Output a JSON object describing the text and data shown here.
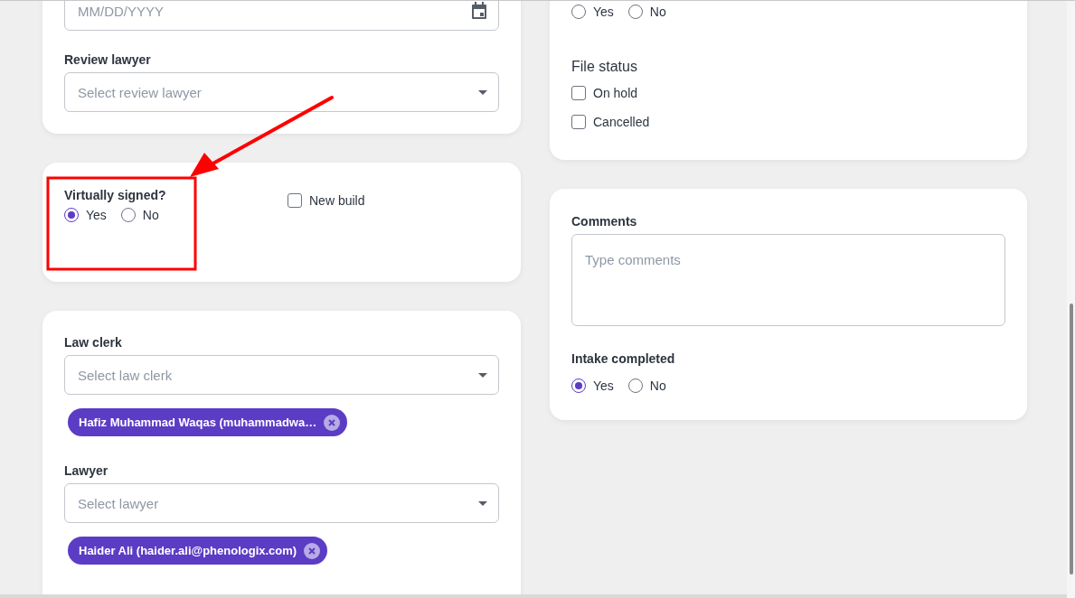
{
  "date_field": {
    "placeholder": "MM/DD/YYYY"
  },
  "review_lawyer": {
    "label": "Review lawyer",
    "placeholder": "Select review lawyer"
  },
  "virtually_signed": {
    "label": "Virtually signed?",
    "options": [
      {
        "label": "Yes",
        "selected": true
      },
      {
        "label": "No",
        "selected": false
      }
    ]
  },
  "new_build": {
    "label": "New build",
    "checked": false
  },
  "assignments": [
    {
      "label": "Law clerk",
      "placeholder": "Select law clerk",
      "chips": [
        "Hafiz Muhammad Waqas (muhammadwa…"
      ]
    },
    {
      "label": "Lawyer",
      "placeholder": "Select lawyer",
      "chips": [
        "Haider Ali (haider.ali@phenologix.com)"
      ]
    }
  ],
  "top_choice": {
    "options": [
      {
        "label": "Yes",
        "selected": false
      },
      {
        "label": "No",
        "selected": false
      }
    ]
  },
  "file_status": {
    "title": "File status",
    "options": [
      {
        "label": "On hold",
        "checked": false
      },
      {
        "label": "Cancelled",
        "checked": false
      }
    ]
  },
  "comments": {
    "label": "Comments",
    "placeholder": "Type comments"
  },
  "intake_completed": {
    "label": "Intake completed",
    "options": [
      {
        "label": "Yes",
        "selected": true
      },
      {
        "label": "No",
        "selected": false
      }
    ]
  }
}
